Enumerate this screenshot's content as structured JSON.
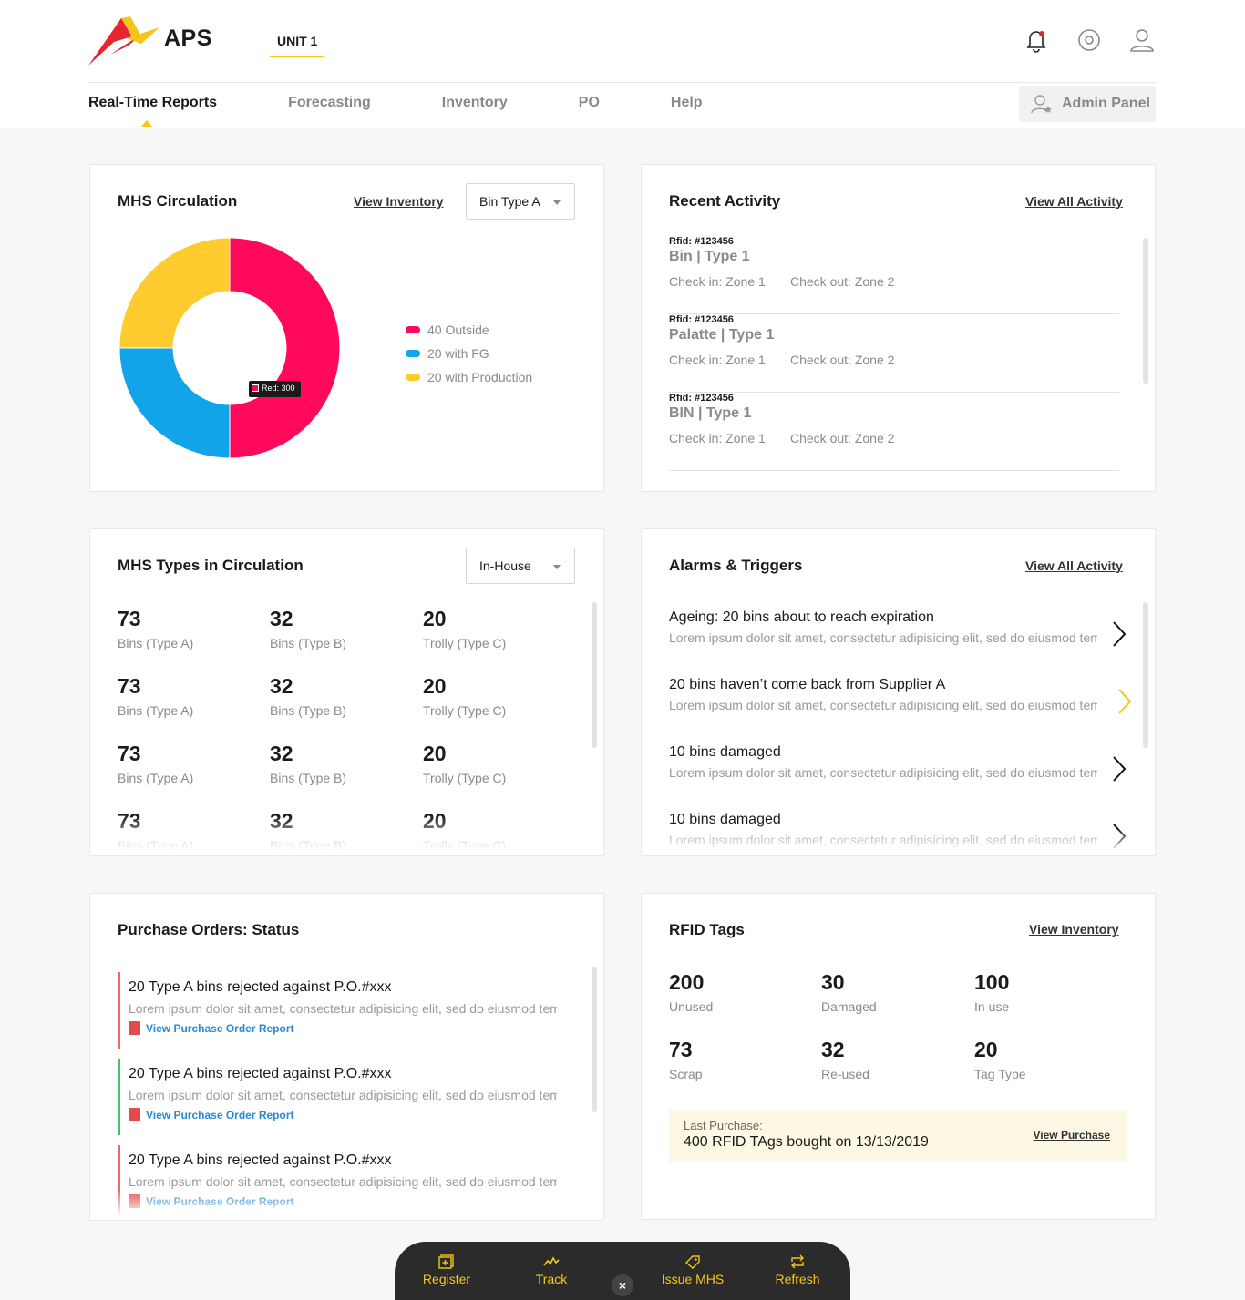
{
  "header": {
    "logo_text": "APS",
    "unit": "UNIT 1",
    "nav": [
      "Real-Time Reports",
      "Forecasting",
      "Inventory",
      "PO",
      "Help"
    ],
    "admin": "Admin Panel"
  },
  "circulation": {
    "title": "MHS Circulation",
    "link": "View Inventory",
    "select": "Bin Type A",
    "tooltip": "Red: 300",
    "legend": [
      {
        "label": "40 Outside",
        "color": "#ff0a5a"
      },
      {
        "label": "20 with FG",
        "color": "#12a4e8"
      },
      {
        "label": "20 with Production",
        "color": "#ffcb2e"
      }
    ]
  },
  "chart_data": {
    "type": "pie",
    "categories": [
      "Outside",
      "with FG",
      "with Production"
    ],
    "values": [
      40,
      20,
      20
    ],
    "colors": [
      "#ff0a5a",
      "#12a4e8",
      "#ffcb2e"
    ],
    "legend": "right"
  },
  "activity": {
    "title": "Recent Activity",
    "link": "View All Activity",
    "items": [
      {
        "rfid": "Rfid: #123456",
        "type": "Bin  |  Type 1",
        "check_in": "Check in: Zone 1",
        "check_out": "Check out: Zone 2"
      },
      {
        "rfid": "Rfid: #123456",
        "type": "Palatte  |  Type 1",
        "check_in": "Check in: Zone 1",
        "check_out": "Check out: Zone 2"
      },
      {
        "rfid": "Rfid: #123456",
        "type": "BIN  |  Type 1",
        "check_in": "Check in: Zone 1",
        "check_out": "Check out: Zone 2"
      }
    ]
  },
  "types": {
    "title": "MHS Types in Circulation",
    "select": "In-House",
    "rows": [
      [
        {
          "num": "73",
          "label": "Bins (Type A)"
        },
        {
          "num": "32",
          "label": "Bins (Type B)"
        },
        {
          "num": "20",
          "label": "Trolly (Type C)"
        }
      ],
      [
        {
          "num": "73",
          "label": "Bins (Type A)"
        },
        {
          "num": "32",
          "label": "Bins (Type B)"
        },
        {
          "num": "20",
          "label": "Trolly (Type C)"
        }
      ],
      [
        {
          "num": "73",
          "label": "Bins (Type A)"
        },
        {
          "num": "32",
          "label": "Bins (Type B)"
        },
        {
          "num": "20",
          "label": "Trolly (Type C)"
        }
      ],
      [
        {
          "num": "73",
          "label": "Bins (Type A)"
        },
        {
          "num": "32",
          "label": "Bins (Type B)"
        },
        {
          "num": "20",
          "label": "Trolly (Type C)"
        }
      ]
    ]
  },
  "alarms": {
    "title": "Alarms & Triggers",
    "link": "View All Activity",
    "items": [
      {
        "title": "Ageing: 20 bins about to reach expiration",
        "desc": "Lorem ipsum dolor sit amet, consectetur adipisicing elit, sed do eiusmod temp..."
      },
      {
        "title": "20 bins haven’t come back from Supplier A",
        "desc": "Lorem ipsum dolor sit amet, consectetur adipisicing elit, sed do eiusmod temp..."
      },
      {
        "title": "10 bins damaged",
        "desc": "Lorem ipsum dolor sit amet, consectetur adipisicing elit, sed do eiusmod temp..."
      },
      {
        "title": "10 bins damaged",
        "desc": "Lorem ipsum dolor sit amet, consectetur adipisicing elit, sed do eiusmod temp..."
      }
    ]
  },
  "po": {
    "title": "Purchase Orders: Status",
    "items": [
      {
        "title": "20 Type A bins rejected against P.O.#xxx",
        "desc": "Lorem ipsum dolor sit amet, consectetur adipisicing elit, sed do eiusmod temp...",
        "link": "View Purchase Order Report",
        "status_color": "#e86a6a"
      },
      {
        "title": "20 Type A bins rejected against P.O.#xxx",
        "desc": "Lorem ipsum dolor sit amet, consectetur adipisicing elit, sed do eiusmod temp...",
        "link": "View Purchase Order Report",
        "status_color": "#3cc86a"
      },
      {
        "title": "20 Type A bins rejected against P.O.#xxx",
        "desc": "Lorem ipsum dolor sit amet, consectetur adipisicing elit, sed do eiusmod temp...",
        "link": "View Purchase Order Report",
        "status_color": "#e86a6a"
      }
    ]
  },
  "rfid": {
    "title": "RFID Tags",
    "link": "View Inventory",
    "stats": [
      {
        "num": "200",
        "label": "Unused"
      },
      {
        "num": "30",
        "label": "Damaged"
      },
      {
        "num": "100",
        "label": "In use"
      },
      {
        "num": "73",
        "label": "Scrap"
      },
      {
        "num": "32",
        "label": "Re-used"
      },
      {
        "num": "20",
        "label": "Tag Type"
      }
    ],
    "last_purchase_label": "Last Purchase:",
    "last_purchase_value": "400 RFID TAgs bought on 13/13/2019",
    "purchase_link": "View Purchase"
  },
  "bottom_bar": {
    "register": "Register",
    "track": "Track",
    "close": "×",
    "issue": "Issue MHS",
    "refresh": "Refresh"
  }
}
